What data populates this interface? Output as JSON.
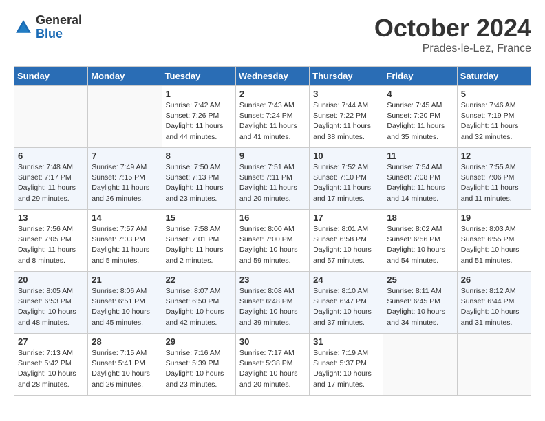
{
  "header": {
    "logo_general": "General",
    "logo_blue": "Blue",
    "month_title": "October 2024",
    "location": "Prades-le-Lez, France"
  },
  "days_of_week": [
    "Sunday",
    "Monday",
    "Tuesday",
    "Wednesday",
    "Thursday",
    "Friday",
    "Saturday"
  ],
  "weeks": [
    [
      {
        "num": "",
        "info": ""
      },
      {
        "num": "",
        "info": ""
      },
      {
        "num": "1",
        "info": "Sunrise: 7:42 AM\nSunset: 7:26 PM\nDaylight: 11 hours and 44 minutes."
      },
      {
        "num": "2",
        "info": "Sunrise: 7:43 AM\nSunset: 7:24 PM\nDaylight: 11 hours and 41 minutes."
      },
      {
        "num": "3",
        "info": "Sunrise: 7:44 AM\nSunset: 7:22 PM\nDaylight: 11 hours and 38 minutes."
      },
      {
        "num": "4",
        "info": "Sunrise: 7:45 AM\nSunset: 7:20 PM\nDaylight: 11 hours and 35 minutes."
      },
      {
        "num": "5",
        "info": "Sunrise: 7:46 AM\nSunset: 7:19 PM\nDaylight: 11 hours and 32 minutes."
      }
    ],
    [
      {
        "num": "6",
        "info": "Sunrise: 7:48 AM\nSunset: 7:17 PM\nDaylight: 11 hours and 29 minutes."
      },
      {
        "num": "7",
        "info": "Sunrise: 7:49 AM\nSunset: 7:15 PM\nDaylight: 11 hours and 26 minutes."
      },
      {
        "num": "8",
        "info": "Sunrise: 7:50 AM\nSunset: 7:13 PM\nDaylight: 11 hours and 23 minutes."
      },
      {
        "num": "9",
        "info": "Sunrise: 7:51 AM\nSunset: 7:11 PM\nDaylight: 11 hours and 20 minutes."
      },
      {
        "num": "10",
        "info": "Sunrise: 7:52 AM\nSunset: 7:10 PM\nDaylight: 11 hours and 17 minutes."
      },
      {
        "num": "11",
        "info": "Sunrise: 7:54 AM\nSunset: 7:08 PM\nDaylight: 11 hours and 14 minutes."
      },
      {
        "num": "12",
        "info": "Sunrise: 7:55 AM\nSunset: 7:06 PM\nDaylight: 11 hours and 11 minutes."
      }
    ],
    [
      {
        "num": "13",
        "info": "Sunrise: 7:56 AM\nSunset: 7:05 PM\nDaylight: 11 hours and 8 minutes."
      },
      {
        "num": "14",
        "info": "Sunrise: 7:57 AM\nSunset: 7:03 PM\nDaylight: 11 hours and 5 minutes."
      },
      {
        "num": "15",
        "info": "Sunrise: 7:58 AM\nSunset: 7:01 PM\nDaylight: 11 hours and 2 minutes."
      },
      {
        "num": "16",
        "info": "Sunrise: 8:00 AM\nSunset: 7:00 PM\nDaylight: 10 hours and 59 minutes."
      },
      {
        "num": "17",
        "info": "Sunrise: 8:01 AM\nSunset: 6:58 PM\nDaylight: 10 hours and 57 minutes."
      },
      {
        "num": "18",
        "info": "Sunrise: 8:02 AM\nSunset: 6:56 PM\nDaylight: 10 hours and 54 minutes."
      },
      {
        "num": "19",
        "info": "Sunrise: 8:03 AM\nSunset: 6:55 PM\nDaylight: 10 hours and 51 minutes."
      }
    ],
    [
      {
        "num": "20",
        "info": "Sunrise: 8:05 AM\nSunset: 6:53 PM\nDaylight: 10 hours and 48 minutes."
      },
      {
        "num": "21",
        "info": "Sunrise: 8:06 AM\nSunset: 6:51 PM\nDaylight: 10 hours and 45 minutes."
      },
      {
        "num": "22",
        "info": "Sunrise: 8:07 AM\nSunset: 6:50 PM\nDaylight: 10 hours and 42 minutes."
      },
      {
        "num": "23",
        "info": "Sunrise: 8:08 AM\nSunset: 6:48 PM\nDaylight: 10 hours and 39 minutes."
      },
      {
        "num": "24",
        "info": "Sunrise: 8:10 AM\nSunset: 6:47 PM\nDaylight: 10 hours and 37 minutes."
      },
      {
        "num": "25",
        "info": "Sunrise: 8:11 AM\nSunset: 6:45 PM\nDaylight: 10 hours and 34 minutes."
      },
      {
        "num": "26",
        "info": "Sunrise: 8:12 AM\nSunset: 6:44 PM\nDaylight: 10 hours and 31 minutes."
      }
    ],
    [
      {
        "num": "27",
        "info": "Sunrise: 7:13 AM\nSunset: 5:42 PM\nDaylight: 10 hours and 28 minutes."
      },
      {
        "num": "28",
        "info": "Sunrise: 7:15 AM\nSunset: 5:41 PM\nDaylight: 10 hours and 26 minutes."
      },
      {
        "num": "29",
        "info": "Sunrise: 7:16 AM\nSunset: 5:39 PM\nDaylight: 10 hours and 23 minutes."
      },
      {
        "num": "30",
        "info": "Sunrise: 7:17 AM\nSunset: 5:38 PM\nDaylight: 10 hours and 20 minutes."
      },
      {
        "num": "31",
        "info": "Sunrise: 7:19 AM\nSunset: 5:37 PM\nDaylight: 10 hours and 17 minutes."
      },
      {
        "num": "",
        "info": ""
      },
      {
        "num": "",
        "info": ""
      }
    ]
  ]
}
